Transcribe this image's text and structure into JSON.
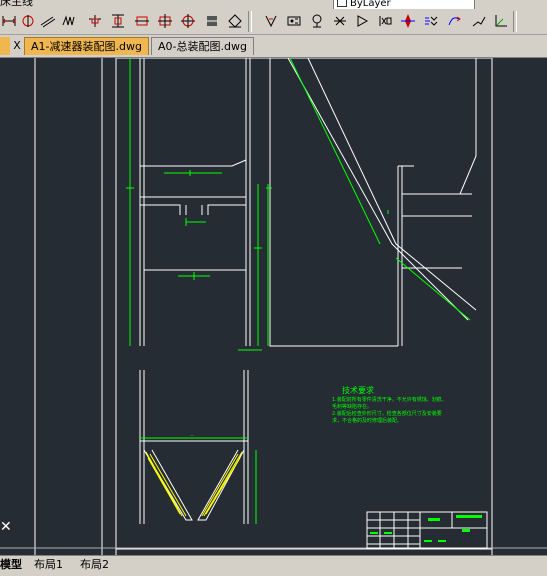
{
  "top_strip": {
    "layer_text": "床主线",
    "linetype": "ByLayer"
  },
  "toolbar": {
    "left_icons": [
      "quick-dimension-icon",
      "linear-dimension-icon",
      "aligned-dimension-icon",
      "arc-length-icon",
      "ordinate-icon",
      "baseline-icon",
      "continue-icon",
      "dim-space-icon",
      "dim-break-icon",
      "tolerance-icon",
      "center-mark-icon",
      "inspection-icon"
    ],
    "right_icons": [
      "jogged-linear-icon",
      "dim-edit-icon",
      "dim-text-edit-icon",
      "dim-update-icon",
      "dim-style-icon",
      "override-icon",
      "snap-icon",
      "dim-reassociate-icon",
      "multileader-icon",
      "multileader-align-icon",
      "leader-icon"
    ]
  },
  "tabs": {
    "close_symbol": "X",
    "items": [
      {
        "label": "A1-减速器装配图.dwg",
        "active": true
      },
      {
        "label": "A0-总装配图.dwg",
        "active": false
      }
    ]
  },
  "drawing": {
    "tech_title": "技术要求",
    "tech_notes": [
      "1.装配前所有零件清洗干净，不允许有锈蚀、划痕、",
      "  毛刺等缺陷存在。",
      "2.装配后检查外形尺寸，检查各部位尺寸及安装要",
      "  求，不合格的及时修理后装配。"
    ],
    "crosshair": "✕",
    "colors": {
      "background": "#262c33",
      "outline": "#ffffff",
      "dimension": "#00ff00",
      "hatch": "#ffff00"
    }
  },
  "layout_tabs": [
    {
      "label": "模型",
      "active": true
    },
    {
      "label": "布局1",
      "active": false
    },
    {
      "label": "布局2",
      "active": false
    }
  ]
}
